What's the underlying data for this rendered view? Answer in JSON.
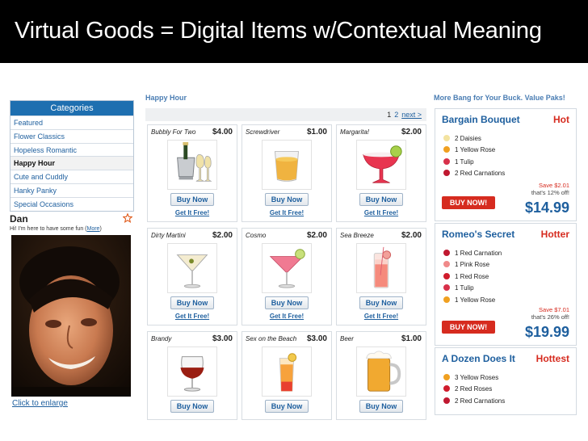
{
  "slide": {
    "title": "Virtual Goods = Digital Items w/Contextual Meaning"
  },
  "categories": {
    "header": "Categories",
    "items": [
      {
        "label": "Featured",
        "active": false
      },
      {
        "label": "Flower Classics",
        "active": false
      },
      {
        "label": "Hopeless Romantic",
        "active": false
      },
      {
        "label": "Happy Hour",
        "active": true
      },
      {
        "label": "Cute and Cuddly",
        "active": false
      },
      {
        "label": "Hanky Panky",
        "active": false
      },
      {
        "label": "Special Occasions",
        "active": false
      }
    ]
  },
  "profile": {
    "name": "Dan",
    "tagline": "Hi! I'm here to have some fun (",
    "more_link": "More",
    "tagline_end": ")",
    "enlarge_link": "Click to enlarge"
  },
  "happy_hour": {
    "title": "Happy Hour",
    "pager": {
      "page1": "1",
      "page2": "2",
      "next": "next >"
    },
    "buy_label": "Buy Now",
    "free_label": "Get It Free!",
    "products": [
      {
        "name": "Bubbly For Two",
        "price": "$4.00",
        "icon": "champagne-icon"
      },
      {
        "name": "Screwdriver",
        "price": "$1.00",
        "icon": "screwdriver-glass-icon"
      },
      {
        "name": "Margarita!",
        "price": "$2.00",
        "icon": "margarita-glass-icon"
      },
      {
        "name": "Dirty Martini",
        "price": "$2.00",
        "icon": "martini-glass-icon"
      },
      {
        "name": "Cosmo",
        "price": "$2.00",
        "icon": "cosmo-glass-icon"
      },
      {
        "name": "Sea Breeze",
        "price": "$2.00",
        "icon": "sea-breeze-glass-icon"
      },
      {
        "name": "Brandy",
        "price": "$3.00",
        "icon": "brandy-glass-icon"
      },
      {
        "name": "Sex on the Beach",
        "price": "$3.00",
        "icon": "cocktail-glass-icon"
      },
      {
        "name": "Beer",
        "price": "$1.00",
        "icon": "beer-mug-icon"
      }
    ]
  },
  "value_paks": {
    "title": "More Bang for Your Buck. Value Paks!",
    "buy_label": "BUY NOW!",
    "paks": [
      {
        "name": "Bargain Bouquet",
        "heat": "Hot",
        "items": [
          {
            "label": "2 Daisies",
            "color": "#f3e3a0"
          },
          {
            "label": "1 Yellow Rose",
            "color": "#f0a020"
          },
          {
            "label": "1 Tulip",
            "color": "#d8304a"
          },
          {
            "label": "2 Red Carnations",
            "color": "#c01830"
          }
        ],
        "save": "Save $2.01",
        "save_note": "that's 12% off!",
        "price": "$14.99"
      },
      {
        "name": "Romeo's Secret",
        "heat": "Hotter",
        "items": [
          {
            "label": "1 Red Carnation",
            "color": "#c01830"
          },
          {
            "label": "1 Pink Rose",
            "color": "#f08a8a"
          },
          {
            "label": "1 Red Rose",
            "color": "#d01c2c"
          },
          {
            "label": "1 Tulip",
            "color": "#d8304a"
          },
          {
            "label": "1 Yellow Rose",
            "color": "#f0a020"
          }
        ],
        "save": "Save $7.01",
        "save_note": "that's 26% off!",
        "price": "$19.99"
      },
      {
        "name": "A Dozen Does It",
        "heat": "Hottest",
        "items": [
          {
            "label": "3 Yellow Roses",
            "color": "#f0a020"
          },
          {
            "label": "2 Red Roses",
            "color": "#d01c2c"
          },
          {
            "label": "2 Red Carnations",
            "color": "#c01830"
          }
        ]
      }
    ]
  },
  "colors": {
    "accent": "#1e6fb0",
    "hot": "#d62b1f",
    "link": "#1e5f9e"
  }
}
